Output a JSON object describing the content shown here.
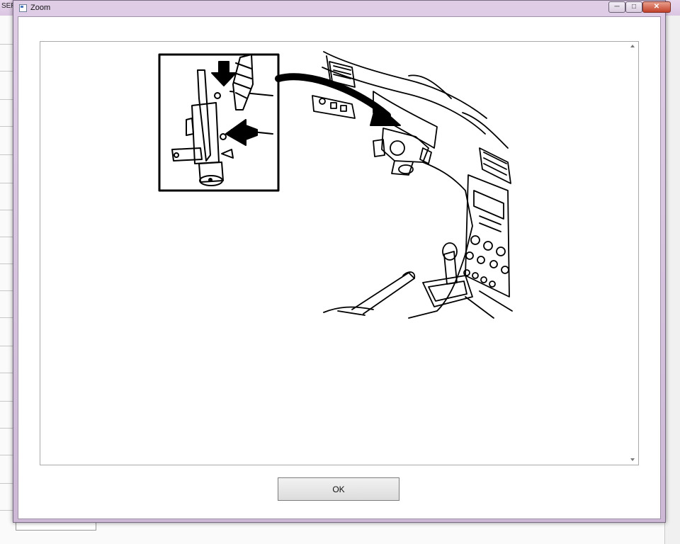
{
  "background_window": {
    "title": "SERV"
  },
  "dialog": {
    "title": "Zoom",
    "controls": {
      "minimize": "─",
      "maximize": "□",
      "close": "✕"
    },
    "ok_label": "OK"
  },
  "illustration": {
    "description": "ignition-switch-removal-diagram",
    "inset": "drill-and-arrows-detail",
    "main": "car-dashboard-interior"
  }
}
